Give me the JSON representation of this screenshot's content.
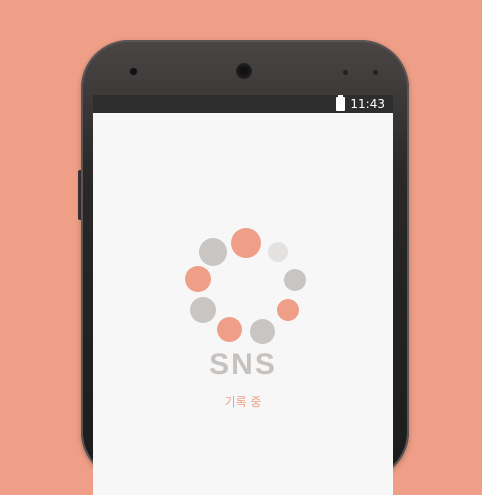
{
  "statusbar": {
    "time": "11:43",
    "battery_icon": "battery-icon"
  },
  "app": {
    "title": "SNS",
    "subtitle": "기록 중"
  },
  "colors": {
    "background": "#ef9f87",
    "accent": "#ef9f87",
    "gray_dot": "#c9c5c2",
    "light_dot": "#e4e2e0",
    "screen": "#f7f7f7",
    "title": "#c6c2bf"
  },
  "spinner": {
    "dots": [
      {
        "color": "accent"
      },
      {
        "color": "light"
      },
      {
        "color": "gray"
      },
      {
        "color": "accent"
      },
      {
        "color": "gray"
      },
      {
        "color": "accent"
      },
      {
        "color": "gray"
      },
      {
        "color": "accent"
      },
      {
        "color": "gray"
      }
    ]
  }
}
